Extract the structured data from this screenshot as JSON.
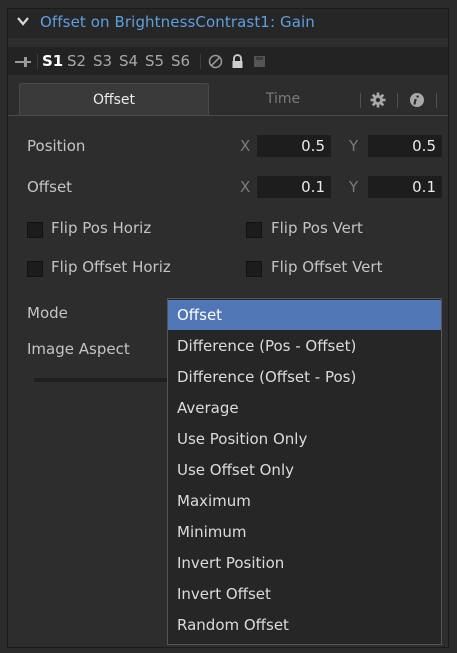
{
  "header": {
    "title": "Offset on BrightnessContrast1: Gain"
  },
  "versions": {
    "items": [
      "S1",
      "S2",
      "S3",
      "S4",
      "S5",
      "S6"
    ],
    "active": "S1"
  },
  "tabs": {
    "offset": "Offset",
    "time": "Time"
  },
  "position": {
    "label": "Position",
    "x_label": "X",
    "x_value": "0.5",
    "y_label": "Y",
    "y_value": "0.5"
  },
  "offset": {
    "label": "Offset",
    "x_label": "X",
    "x_value": "0.1",
    "y_label": "Y",
    "y_value": "0.1"
  },
  "checkboxes": {
    "flip_pos_horiz": "Flip Pos Horiz",
    "flip_pos_vert": "Flip Pos Vert",
    "flip_offset_horiz": "Flip Offset Horiz",
    "flip_offset_vert": "Flip Offset Vert"
  },
  "mode": {
    "label": "Mode"
  },
  "image_aspect": {
    "label": "Image Aspect"
  },
  "dropdown": {
    "selected": "Offset",
    "options": [
      "Offset",
      "Difference (Pos - Offset)",
      "Difference (Offset - Pos)",
      "Average",
      "Use Position Only",
      "Use Offset Only",
      "Maximum",
      "Minimum",
      "Invert Position",
      "Invert Offset",
      "Random Offset"
    ]
  },
  "colors": {
    "title_blue": "#5e9fe0",
    "selection_blue": "#5176b6"
  }
}
